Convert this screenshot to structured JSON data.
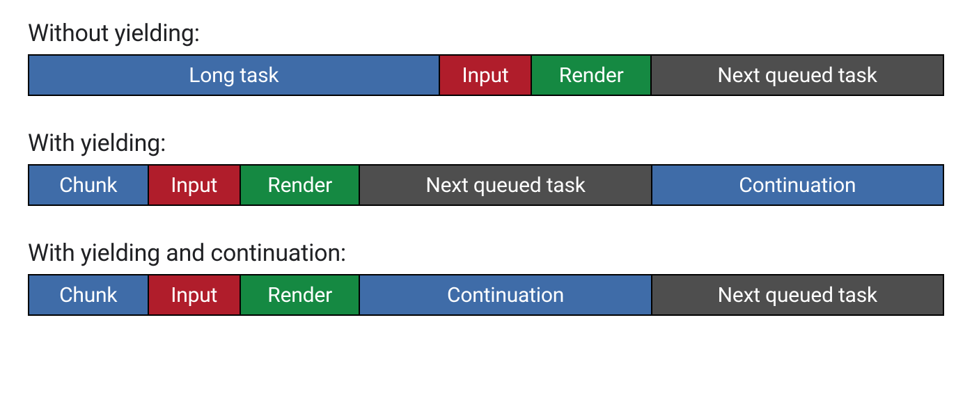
{
  "colors": {
    "blue": "#3f6ca8",
    "red": "#b01d2b",
    "green": "#158942",
    "gray": "#4e4e4e"
  },
  "chart_data": [
    {
      "type": "bar",
      "title": "Without yielding:",
      "series": [
        {
          "name": "Long task",
          "value": 45,
          "color": "blue"
        },
        {
          "name": "Input",
          "value": 10,
          "color": "red"
        },
        {
          "name": "Render",
          "value": 13,
          "color": "green"
        },
        {
          "name": "Next queued task",
          "value": 32,
          "color": "gray"
        }
      ]
    },
    {
      "type": "bar",
      "title": "With yielding:",
      "series": [
        {
          "name": "Chunk",
          "value": 13,
          "color": "blue"
        },
        {
          "name": "Input",
          "value": 10,
          "color": "red"
        },
        {
          "name": "Render",
          "value": 13,
          "color": "green"
        },
        {
          "name": "Next queued task",
          "value": 32,
          "color": "gray"
        },
        {
          "name": "Continuation",
          "value": 32,
          "color": "blue"
        }
      ]
    },
    {
      "type": "bar",
      "title": "With yielding and continuation:",
      "series": [
        {
          "name": "Chunk",
          "value": 13,
          "color": "blue"
        },
        {
          "name": "Input",
          "value": 10,
          "color": "red"
        },
        {
          "name": "Render",
          "value": 13,
          "color": "green"
        },
        {
          "name": "Continuation",
          "value": 32,
          "color": "blue"
        },
        {
          "name": "Next queued task",
          "value": 32,
          "color": "gray"
        }
      ]
    }
  ]
}
